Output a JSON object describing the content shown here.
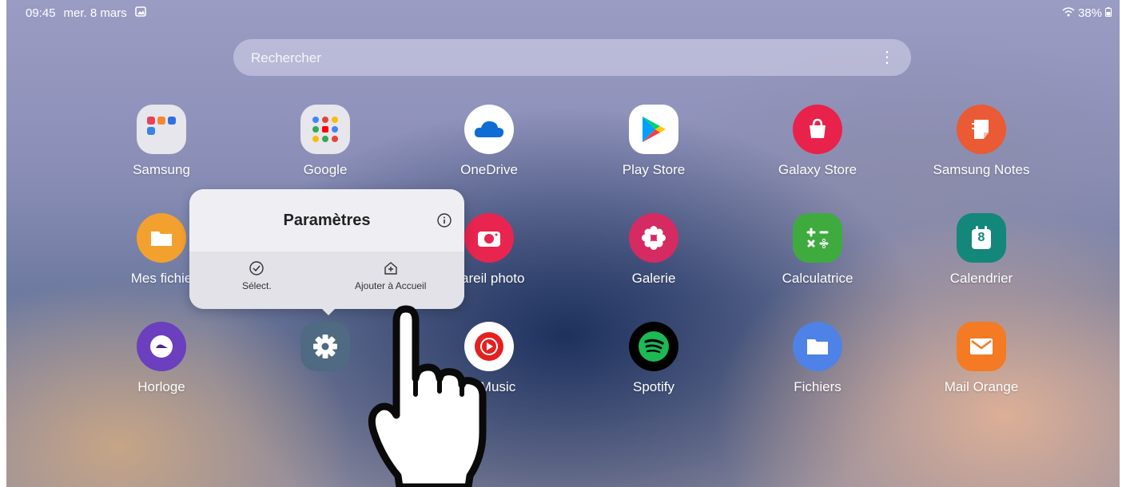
{
  "status": {
    "time": "09:45",
    "date": "mer. 8 mars",
    "battery": "38%"
  },
  "search": {
    "placeholder": "Rechercher"
  },
  "apps": [
    {
      "label": "Samsung",
      "icon": "samsung-folder-icon"
    },
    {
      "label": "Google",
      "icon": "google-folder-icon"
    },
    {
      "label": "OneDrive",
      "icon": "onedrive-icon"
    },
    {
      "label": "Play Store",
      "icon": "play-store-icon"
    },
    {
      "label": "Galaxy Store",
      "icon": "galaxy-store-icon"
    },
    {
      "label": "Samsung Notes",
      "icon": "samsung-notes-icon"
    },
    {
      "label": "Mes fichie",
      "icon": "my-files-icon"
    },
    {
      "label": "pareil photo",
      "icon": "camera-icon"
    },
    {
      "label": "Galerie",
      "icon": "gallery-icon"
    },
    {
      "label": "Calculatrice",
      "icon": "calculator-icon"
    },
    {
      "label": "Calendrier",
      "icon": "calendar-icon"
    },
    {
      "label": "Horloge",
      "icon": "clock-icon"
    },
    {
      "label": "Paramètres",
      "icon": "settings-gear-icon"
    },
    {
      "label": "Music",
      "icon": "youtube-music-icon"
    },
    {
      "label": "Spotify",
      "icon": "spotify-icon"
    },
    {
      "label": "Fichiers",
      "icon": "files-icon"
    },
    {
      "label": "Mail Orange",
      "icon": "mail-orange-icon"
    }
  ],
  "popup": {
    "title": "Paramètres",
    "select_label": "Sélect.",
    "add_home_label": "Ajouter à Accueil"
  },
  "calendar_day": "8",
  "colors": {
    "galaxy_store": "#e8224a",
    "notes": "#ea5a34",
    "files": "#f3a12e",
    "camera": "#e8254f",
    "gallery": "#d62a63",
    "calculator": "#3fab3e",
    "calendar": "#13877a",
    "clock": "#6b3fbd",
    "settings": "#4f6a82",
    "ytmusic": "#e52020",
    "spotify": "#1db954",
    "fichiers": "#4f82e6",
    "mail": "#f47a24"
  }
}
